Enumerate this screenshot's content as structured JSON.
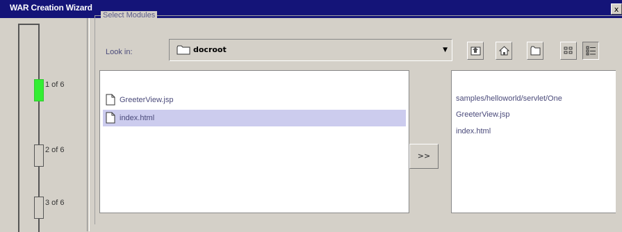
{
  "window": {
    "title": "WAR Creation Wizard",
    "close_glyph": "x"
  },
  "steps": [
    {
      "label": "1 of 6",
      "active": true,
      "color": "#33ee33"
    },
    {
      "label": "2 of 6",
      "active": false
    },
    {
      "label": "3 of 6",
      "active": false
    }
  ],
  "group": {
    "title": "Select Modules"
  },
  "look_in": {
    "label": "Look in:",
    "value": "docroot",
    "icon": "folder-icon"
  },
  "toolbar": {
    "icons": [
      "up-one-level-icon",
      "home-icon",
      "new-folder-icon",
      "list-view-icon",
      "details-view-icon"
    ]
  },
  "files": [
    {
      "name": "GreeterView.jsp",
      "selected": false,
      "icon": "file-icon"
    },
    {
      "name": "index.html",
      "selected": true,
      "icon": "file-icon"
    }
  ],
  "add_button": {
    "label": ">>"
  },
  "selected_modules": [
    "samples/helloworld/servlet/One",
    "GreeterView.jsp",
    "index.html"
  ],
  "colors": {
    "titlebar": "#141478",
    "selection": "#ccccee",
    "active_step": "#33ee33"
  }
}
